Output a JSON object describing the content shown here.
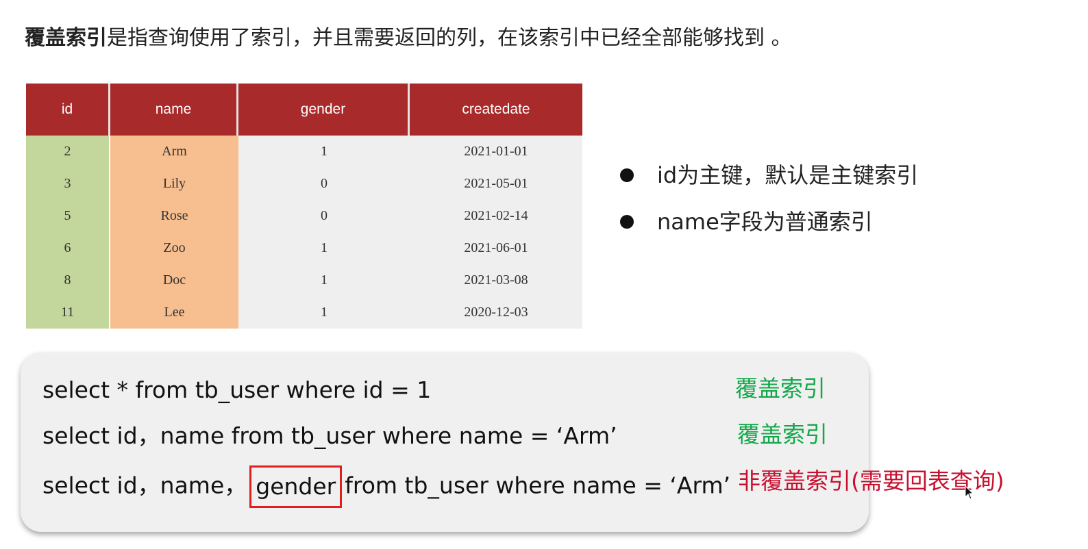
{
  "heading": {
    "bold_text": "覆盖索引",
    "rest_text": "是指查询使用了索引，并且需要返回的列，在该索引中已经全部能够找到 。"
  },
  "table": {
    "headers": [
      "id",
      "name",
      "gender",
      "createdate"
    ],
    "rows": [
      [
        "2",
        "Arm",
        "1",
        "2021-01-01"
      ],
      [
        "3",
        "Lily",
        "0",
        "2021-05-01"
      ],
      [
        "5",
        "Rose",
        "0",
        "2021-02-14"
      ],
      [
        "6",
        "Zoo",
        "1",
        "2021-06-01"
      ],
      [
        "8",
        "Doc",
        "1",
        "2021-03-08"
      ],
      [
        "11",
        "Lee",
        "1",
        "2020-12-03"
      ]
    ]
  },
  "bullets": [
    "id为主键，默认是主键索引",
    "name字段为普通索引"
  ],
  "queries": [
    {
      "before": "select * from tb_user where id = 1",
      "highlight": "",
      "after": "",
      "tag": "覆盖索引"
    },
    {
      "before": "select id，name from tb_user where name =   ‘Arm’",
      "highlight": "",
      "after": "",
      "tag": "覆盖索引"
    },
    {
      "before": "select id，name，",
      "highlight": "gender",
      "after": "from tb_user where name =   ‘Arm’",
      "tag": "非覆盖索引(需要回表查询)"
    }
  ],
  "colors": {
    "header_red": "#a82a2a",
    "id_column_green": "#c3d69b",
    "name_column_orange": "#f7bf8f",
    "covering_tag_green": "#12a84a",
    "non_covering_tag_red": "#c8102e",
    "highlight_border": "#e02020"
  }
}
